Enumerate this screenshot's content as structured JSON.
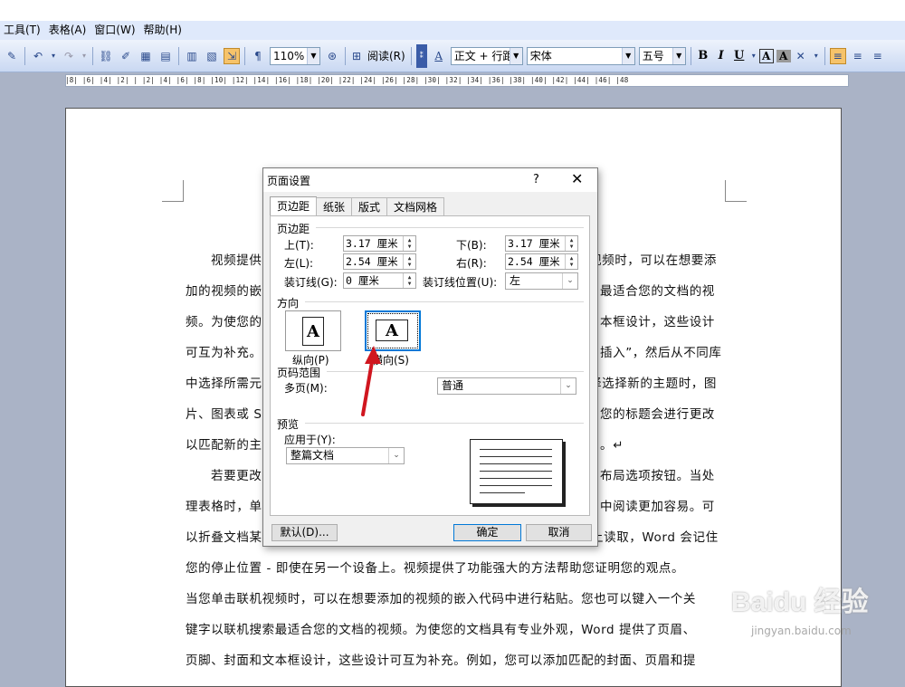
{
  "menubar": {
    "items": [
      "工具(T)",
      "表格(A)",
      "窗口(W)",
      "帮助(H)"
    ]
  },
  "toolbar": {
    "zoom": "110%",
    "read_label": "阅读(R)",
    "style": "正文 + 行距",
    "font": "宋体",
    "size": "五号",
    "bold": "B",
    "italic": "I",
    "underline": "U",
    "highlight": "A",
    "char_shading": "A"
  },
  "ruler": {
    "numbers": "|8| |6| |4| |2| | |2| |4| |6| |8| |10| |12| |14| |16| |18| |20| |22| |24| |26| |28| |30| |32| |34| |36| |38| |40| |42| |44| |46| |48"
  },
  "document": {
    "lines": [
      "视频提供",
      "加的视频的嵌",
      "频。为使您的",
      "可互为补充。",
      "中选择所需元",
      "片、图表或 S",
      "以匹配新的主",
      "若要更改",
      "理表格时，单",
      "以折叠文档某",
      "您的停止位置 - 即使在另一个设备上。视频提供了功能强大的方法帮助您证明您的观点。",
      "当您单击联机视频时，可以在想要添加的视频的嵌入代码中进行粘贴。您也可以键入一个关",
      "键字以联机搜索最适合您的文档的视频。为使您的文档具有专业外观，Word 提供了页眉、",
      "页脚、封面和文本框设计，这些设计可互为补充。例如，您可以添加匹配的封面、页眉和提"
    ],
    "right_fragments": [
      "视频时，可以在想要添",
      "最适合您的文档的视",
      "本框设计，这些设计",
      "插入”，然后从不同库",
      "择选择新的主题时，图",
      "您的标题会进行更改",
      "。↵",
      "布局选项按钮。当处",
      "中阅读更加容易。可",
      "上读取，Word 会记住"
    ]
  },
  "dialog": {
    "title": "页面设置",
    "help": "?",
    "close": "✕",
    "tabs": [
      "页边距",
      "纸张",
      "版式",
      "文档网格"
    ],
    "margins_section": "页边距",
    "top_label": "上(T):",
    "top_value": "3.17 厘米",
    "bottom_label": "下(B):",
    "bottom_value": "3.17 厘米",
    "left_label": "左(L):",
    "left_value": "2.54 厘米",
    "right_label": "右(R):",
    "right_value": "2.54 厘米",
    "gutter_label": "装订线(G):",
    "gutter_value": "0 厘米",
    "gutter_pos_label": "装订线位置(U):",
    "gutter_pos_value": "左",
    "orientation_section": "方向",
    "portrait_label": "纵向(P)",
    "landscape_label": "横向(S)",
    "pages_section": "页码范围",
    "multi_label": "多页(M):",
    "multi_value": "普通",
    "preview_section": "预览",
    "apply_label": "应用于(Y):",
    "apply_value": "整篇文档",
    "default_btn": "默认(D)...",
    "ok_btn": "确定",
    "cancel_btn": "取消"
  },
  "watermark": {
    "logo": "Baidu 经验",
    "url": "jingyan.baidu.com"
  }
}
